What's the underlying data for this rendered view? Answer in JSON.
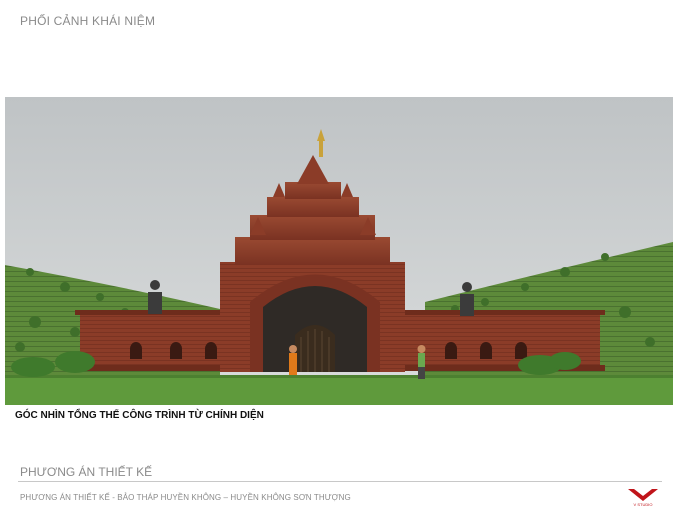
{
  "header": {
    "title": "PHỐI CẢNH KHÁI NIỆM"
  },
  "render": {
    "caption": "GÓC NHÌN TỔNG THỂ CÔNG TRÌNH TỪ CHÍNH DIỆN"
  },
  "section": {
    "title": "PHƯƠNG ÁN THIẾT KẾ"
  },
  "footer": {
    "subtitle": "PHƯƠNG ÁN THIẾT KẾ - BẢO THÁP HUYỀN KHÔNG – HUYỀN KHÔNG SƠN THƯỢNG",
    "logo_text": "V STUDIO"
  },
  "colors": {
    "brick": "#8a3a26",
    "sky": "#d4d7d8",
    "grass": "#5f8e3c",
    "logo_red": "#c0141a"
  }
}
